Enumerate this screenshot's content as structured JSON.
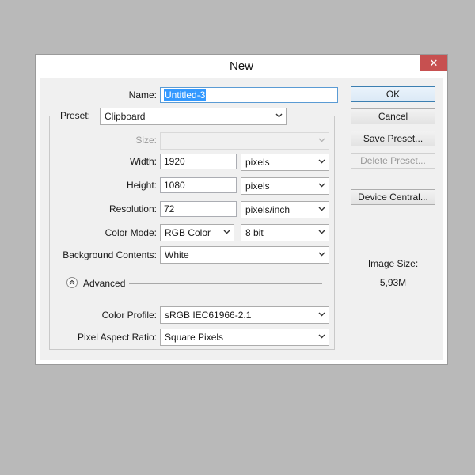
{
  "dialog": {
    "title": "New",
    "close_glyph": "✕"
  },
  "fields": {
    "name_label": "Name:",
    "name_value": "Untitled-3",
    "preset_label": "Preset:",
    "preset_value": "Clipboard",
    "size_label": "Size:",
    "size_value": "",
    "width_label": "Width:",
    "width_value": "1920",
    "width_unit": "pixels",
    "height_label": "Height:",
    "height_value": "1080",
    "height_unit": "pixels",
    "resolution_label": "Resolution:",
    "resolution_value": "72",
    "resolution_unit": "pixels/inch",
    "color_mode_label": "Color Mode:",
    "color_mode_value": "RGB Color",
    "bit_depth_value": "8 bit",
    "background_label": "Background Contents:",
    "background_value": "White",
    "advanced_label": "Advanced",
    "color_profile_label": "Color Profile:",
    "color_profile_value": "sRGB IEC61966-2.1",
    "pixel_aspect_label": "Pixel Aspect Ratio:",
    "pixel_aspect_value": "Square Pixels"
  },
  "buttons": {
    "ok": "OK",
    "cancel": "Cancel",
    "save_preset": "Save Preset...",
    "delete_preset": "Delete Preset...",
    "device_central": "Device Central..."
  },
  "info": {
    "image_size_label": "Image Size:",
    "image_size_value": "5,93M"
  },
  "colors": {
    "close_button": "#c75050",
    "selection": "#3399ff",
    "focus_border": "#5a9bd4"
  }
}
